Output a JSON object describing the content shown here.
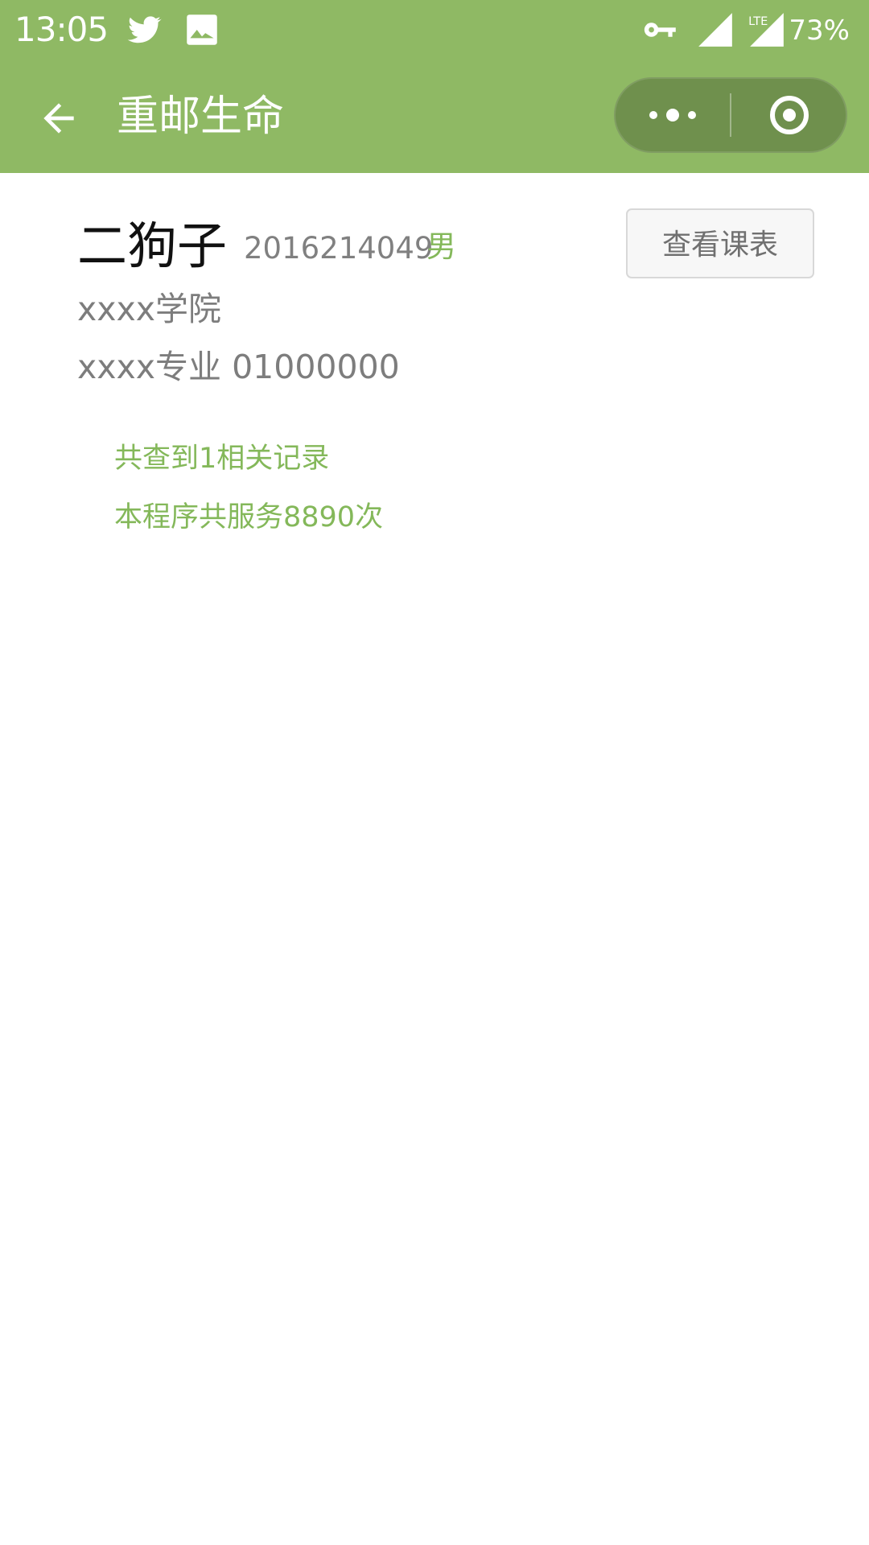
{
  "status_bar": {
    "time": "13:05",
    "battery": "73%",
    "icons": [
      "twitter-icon",
      "image-icon",
      "key-icon",
      "signal-icon",
      "lte-icon"
    ]
  },
  "nav": {
    "title": "重邮生命",
    "back_icon": "arrow-left-icon",
    "more_icon": "more-icon",
    "close_icon": "target-circle-icon",
    "bar_color": "#8fb964",
    "capsule_color": "#6f904d"
  },
  "profile": {
    "name": "二狗子",
    "student_id": "2016214049",
    "gender": "男",
    "college": "xxxx学院",
    "major": "xxxx专业 01000000",
    "timetable_button": "查看课表"
  },
  "stats": {
    "records_text": "共查到1相关记录",
    "served_text": "本程序共服务8890次"
  },
  "colors": {
    "accent_green": "#84b85a",
    "gray_text": "#7d7d7d"
  }
}
